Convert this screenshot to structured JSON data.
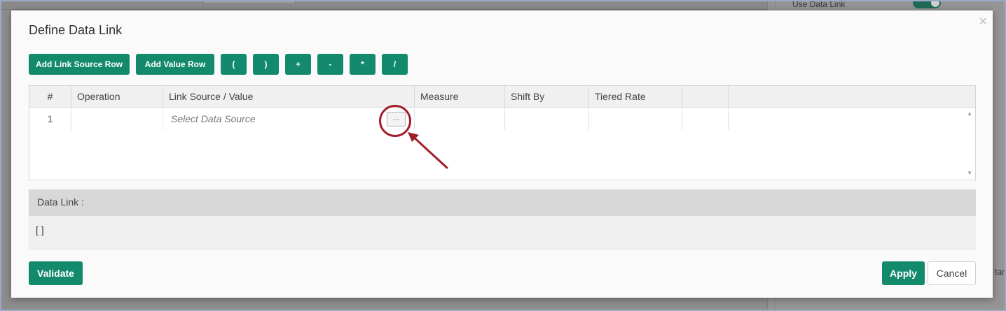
{
  "background": {
    "use_data_link_label": "Use Data Link",
    "clipped_text": "tary"
  },
  "modal": {
    "title": "Define Data Link",
    "close_glyph": "×"
  },
  "toolbar": {
    "add_link_source_row": "Add Link Source Row",
    "add_value_row": "Add Value Row",
    "operators": [
      "(",
      ")",
      "+",
      "-",
      "*",
      "/"
    ]
  },
  "grid": {
    "columns": [
      "#",
      "Operation",
      "Link Source / Value",
      "Measure",
      "Shift By",
      "Tiered Rate",
      ""
    ],
    "rows": [
      {
        "index": "1",
        "operation": "",
        "link_source_placeholder": "Select Data Source",
        "browse_button": "...",
        "measure": "",
        "shift_by": "",
        "tiered_rate": ""
      }
    ],
    "scroll_up_glyph": "▲",
    "scroll_down_glyph": "▼"
  },
  "data_link": {
    "label": "Data Link :",
    "value": "[ ]"
  },
  "footer": {
    "validate": "Validate",
    "apply": "Apply",
    "cancel": "Cancel"
  },
  "colors": {
    "primary": "#138a6c",
    "annotation": "#a01f2a"
  }
}
